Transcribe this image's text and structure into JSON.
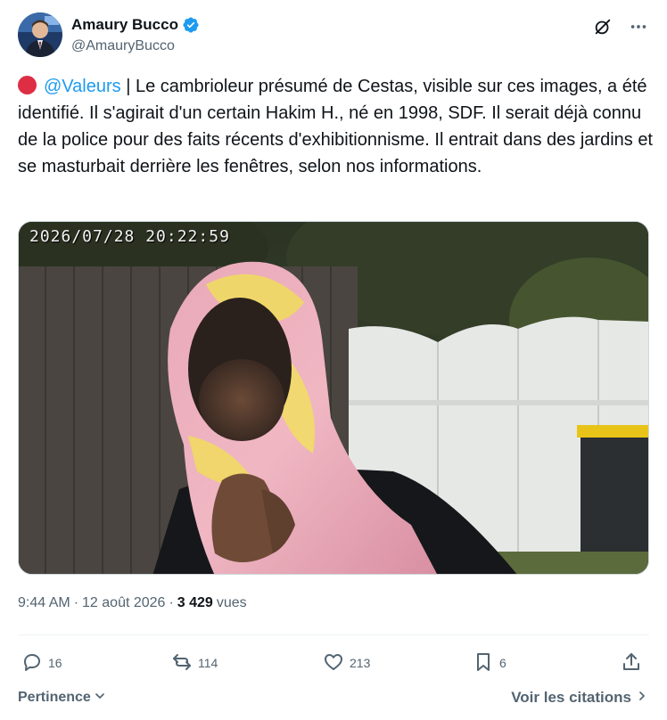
{
  "author": {
    "display_name": "Amaury Bucco",
    "handle": "@AmauryBucco",
    "verified": true
  },
  "tweet": {
    "mention": "@Valeurs",
    "text": " | Le cambrioleur présumé de Cestas, visible sur ces images, a été identifié. Il s'agirait d'un certain Hakim H., né en 1998, SDF. Il serait déjà connu de la police pour des faits récents d'exhibitionnisme. Il entrait dans des jardins et se masturbait derrière les fenêtres, selon nos informations."
  },
  "media": {
    "overlay_timestamp": "2026/07/28 20:22:59"
  },
  "meta": {
    "time": "9:44 AM",
    "separator": "·",
    "date": "12 août 2026",
    "separator2": "·",
    "views_count": "3 429",
    "views_label": "vues"
  },
  "actions": {
    "replies": "16",
    "reposts": "114",
    "likes": "213",
    "bookmarks": "6"
  },
  "footer": {
    "sort_label": "Pertinence",
    "quotes_label": "Voir les citations"
  },
  "icons": {
    "header": [
      "grok-icon",
      "more-icon"
    ],
    "actions": [
      "reply-icon",
      "repost-icon",
      "like-icon",
      "bookmark-icon",
      "share-icon"
    ]
  },
  "colors": {
    "accent": "#1d9bf0",
    "muted": "#536471",
    "text": "#0f1419",
    "red_dot": "#dd2e44"
  }
}
